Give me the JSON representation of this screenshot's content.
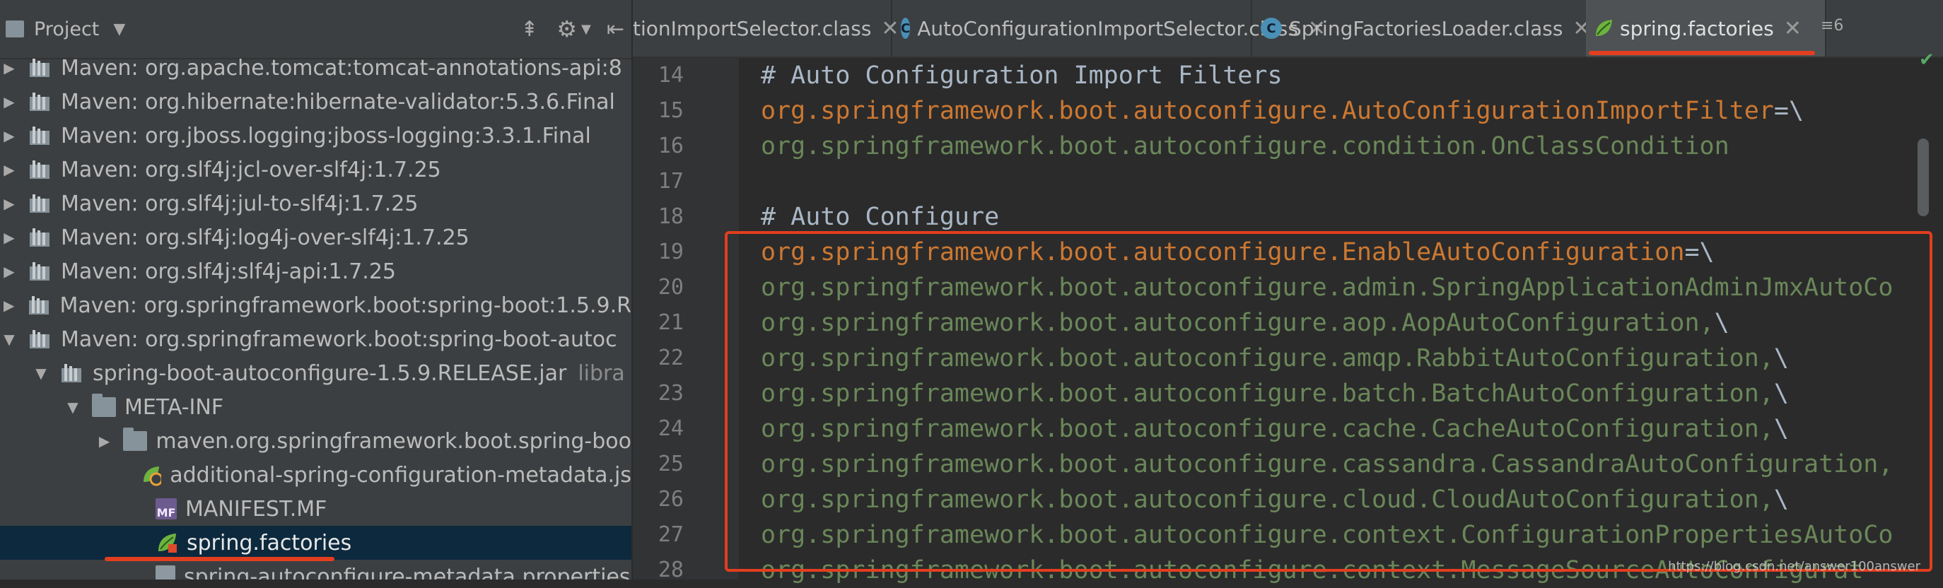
{
  "project": {
    "title": "Project",
    "tree": [
      {
        "arrow": "▶",
        "icon": "jar-icon",
        "text": "Maven: org.apache.tomcat:tomcat-annotations-api:8"
      },
      {
        "arrow": "▶",
        "icon": "jar-icon",
        "text": "Maven: org.hibernate:hibernate-validator:5.3.6.Final"
      },
      {
        "arrow": "▶",
        "icon": "jar-icon",
        "text": "Maven: org.jboss.logging:jboss-logging:3.3.1.Final"
      },
      {
        "arrow": "▶",
        "icon": "jar-icon",
        "text": "Maven: org.slf4j:jcl-over-slf4j:1.7.25"
      },
      {
        "arrow": "▶",
        "icon": "jar-icon",
        "text": "Maven: org.slf4j:jul-to-slf4j:1.7.25"
      },
      {
        "arrow": "▶",
        "icon": "jar-icon",
        "text": "Maven: org.slf4j:log4j-over-slf4j:1.7.25"
      },
      {
        "arrow": "▶",
        "icon": "jar-icon",
        "text": "Maven: org.slf4j:slf4j-api:1.7.25"
      },
      {
        "arrow": "▶",
        "icon": "jar-icon",
        "text": "Maven: org.springframework.boot:spring-boot:1.5.9.R"
      },
      {
        "arrow": "▼",
        "icon": "jar-icon",
        "text": "Maven: org.springframework.boot:spring-boot-autoc"
      },
      {
        "arrow": "▼",
        "icon": "jar-icon",
        "text": "spring-boot-autoconfigure-1.5.9.RELEASE.jar",
        "extra": "libra"
      },
      {
        "arrow": "▼",
        "icon": "folder-icon",
        "text": "META-INF"
      },
      {
        "arrow": "▶",
        "icon": "folder-icon",
        "text": "maven.org.springframework.boot.spring-boo"
      },
      {
        "arrow": "",
        "icon": "json-icon",
        "text": "additional-spring-configuration-metadata.js"
      },
      {
        "arrow": "",
        "icon": "manifest-icon",
        "text": "MANIFEST.MF",
        "badge": "MF"
      },
      {
        "arrow": "",
        "icon": "spring-leaf-icon",
        "text": "spring.factories",
        "selected": true
      },
      {
        "arrow": "",
        "icon": "properties-icon",
        "text": "spring-autoconfigure-metadata.properties"
      }
    ]
  },
  "tabs": [
    {
      "label": "tionImportSelector.class",
      "icon": "",
      "active": false
    },
    {
      "label": "AutoConfigurationImportSelector.class",
      "icon": "C",
      "active": false
    },
    {
      "label": "SpringFactoriesLoader.class",
      "icon": "C",
      "active": false
    },
    {
      "label": "spring.factories",
      "icon": "leaf",
      "active": true
    }
  ],
  "tab_overflow": "≡6",
  "editor": {
    "lines": [
      {
        "n": "14",
        "parts": [
          {
            "t": "# Auto Configuration Import Filters",
            "c": "k-comment"
          }
        ]
      },
      {
        "n": "15",
        "parts": [
          {
            "t": "org.springframework.boot.autoconfigure.AutoConfigurationImportFilter",
            "c": "k-key"
          },
          {
            "t": "=\\",
            "c": "k-op"
          }
        ]
      },
      {
        "n": "16",
        "parts": [
          {
            "t": "org.springframework.boot.autoconfigure.condition.OnClassCondition",
            "c": "k-val"
          }
        ]
      },
      {
        "n": "17",
        "parts": []
      },
      {
        "n": "18",
        "parts": [
          {
            "t": "# Auto Configure",
            "c": "k-comment"
          }
        ]
      },
      {
        "n": "19",
        "parts": [
          {
            "t": "org.springframework.boot.autoconfigure.EnableAutoConfiguration",
            "c": "k-key"
          },
          {
            "t": "=\\",
            "c": "k-op"
          }
        ]
      },
      {
        "n": "20",
        "parts": [
          {
            "t": "org.springframework.boot.autoconfigure.admin.SpringApplicationAdminJmxAutoCo",
            "c": "k-val"
          }
        ]
      },
      {
        "n": "21",
        "parts": [
          {
            "t": "org.springframework.boot.autoconfigure.aop.AopAutoConfiguration,",
            "c": "k-val"
          },
          {
            "t": "\\",
            "c": "k-op"
          }
        ]
      },
      {
        "n": "22",
        "parts": [
          {
            "t": "org.springframework.boot.autoconfigure.amqp.RabbitAutoConfiguration,",
            "c": "k-val"
          },
          {
            "t": "\\",
            "c": "k-op"
          }
        ]
      },
      {
        "n": "23",
        "parts": [
          {
            "t": "org.springframework.boot.autoconfigure.batch.BatchAutoConfiguration,",
            "c": "k-val"
          },
          {
            "t": "\\",
            "c": "k-op"
          }
        ]
      },
      {
        "n": "24",
        "parts": [
          {
            "t": "org.springframework.boot.autoconfigure.cache.CacheAutoConfiguration,",
            "c": "k-val"
          },
          {
            "t": "\\",
            "c": "k-op"
          }
        ]
      },
      {
        "n": "25",
        "parts": [
          {
            "t": "org.springframework.boot.autoconfigure.cassandra.CassandraAutoConfiguration,",
            "c": "k-val"
          }
        ]
      },
      {
        "n": "26",
        "parts": [
          {
            "t": "org.springframework.boot.autoconfigure.cloud.CloudAutoConfiguration,",
            "c": "k-val"
          },
          {
            "t": "\\",
            "c": "k-op"
          }
        ]
      },
      {
        "n": "27",
        "parts": [
          {
            "t": "org.springframework.boot.autoconfigure.context.ConfigurationPropertiesAutoCo",
            "c": "k-val"
          }
        ]
      },
      {
        "n": "28",
        "parts": [
          {
            "t": "org.springframework.boot.autoconfigure.context.MessageSourceAutoConfigurat",
            "c": "k-val"
          }
        ]
      }
    ]
  },
  "watermark": "https://blog.csdn.net/answer100answer",
  "colors": {
    "annotation_red": "#e33e1f",
    "spring_green": "#6db33f",
    "check_green": "#59a869"
  }
}
